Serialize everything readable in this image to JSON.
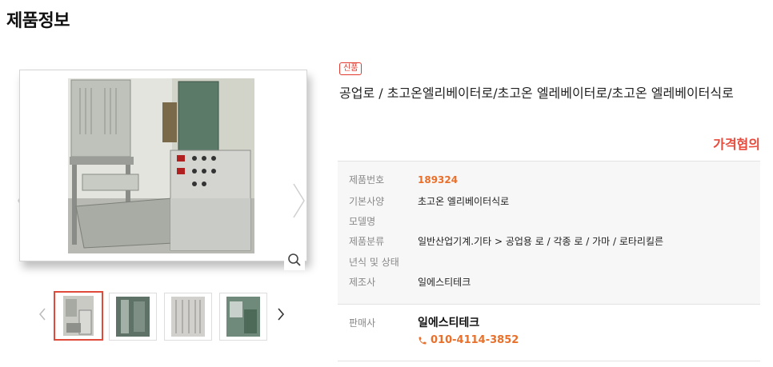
{
  "page": {
    "title": "제품정보"
  },
  "product": {
    "badge": "신품",
    "title": "공업로 / 초고온엘리베이터로/초고온 엘레베이터로/초고온 엘레베이터식로",
    "price": "가격협의"
  },
  "specs": [
    {
      "key": "제품번호",
      "value": "189324"
    },
    {
      "key": "기본사양",
      "value": "초고온 엘리베이터식로"
    },
    {
      "key": "모델명",
      "value": ""
    },
    {
      "key": "제품분류",
      "value": "일반산업기계.기타 > 공업용 로 / 각종 로 / 가마 / 로타리킬른"
    },
    {
      "key": "년식 및 상태",
      "value": ""
    },
    {
      "key": "제조사",
      "value": "일에스티테크"
    }
  ],
  "seller": {
    "label": "판매사",
    "name": "일에스티테크",
    "phone": "010-4114-3852"
  },
  "colors": {
    "accent": "#e8702b",
    "price": "#e84a3c",
    "badge": "#e13a2f"
  },
  "icons": [
    "chevron-left-icon",
    "chevron-right-icon",
    "zoom-icon",
    "phone-icon"
  ]
}
